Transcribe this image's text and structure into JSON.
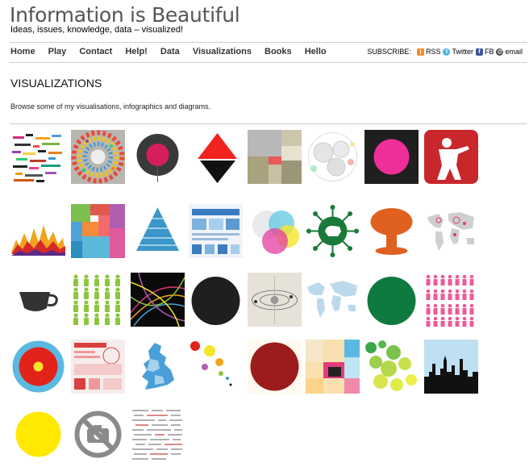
{
  "site": {
    "title": "Information is Beautiful",
    "tagline": "Ideas, issues, knowledge, data – visualized!"
  },
  "nav": {
    "items": [
      "Home",
      "Play",
      "Contact",
      "Help!",
      "Data",
      "Visualizations",
      "Books",
      "Hello"
    ]
  },
  "subscribe": {
    "label": "SUBSCRIBE:",
    "links": [
      {
        "label": "RSS",
        "icon": "rss-icon",
        "color": "#f08a24"
      },
      {
        "label": "Twitter",
        "icon": "twitter-icon",
        "color": "#49b3e6"
      },
      {
        "label": "FB",
        "icon": "facebook-icon",
        "color": "#3b5998"
      },
      {
        "label": "email",
        "icon": "email-icon",
        "color": "#444444"
      }
    ]
  },
  "page": {
    "title": "VISUALIZATIONS",
    "intro": "Browse some of my visualisations, infographics and diagrams."
  },
  "thumbnails": [
    {
      "name": "thumb-color-chart"
    },
    {
      "name": "thumb-color-wheel"
    },
    {
      "name": "thumb-dark-circle"
    },
    {
      "name": "thumb-triangles"
    },
    {
      "name": "thumb-treemap-beige"
    },
    {
      "name": "thumb-circle-network"
    },
    {
      "name": "thumb-pink-dot"
    },
    {
      "name": "thumb-soldier"
    },
    {
      "name": "thumb-mountain-chart"
    },
    {
      "name": "thumb-colored-treemap"
    },
    {
      "name": "thumb-pyramid"
    },
    {
      "name": "thumb-blue-infographic"
    },
    {
      "name": "thumb-venn-diagram"
    },
    {
      "name": "thumb-virus"
    },
    {
      "name": "thumb-mushroom-cloud"
    },
    {
      "name": "thumb-world-map-pink"
    },
    {
      "name": "thumb-teacup"
    },
    {
      "name": "thumb-green-people"
    },
    {
      "name": "thumb-rainbow-lines"
    },
    {
      "name": "thumb-black-circle"
    },
    {
      "name": "thumb-orbit-diagram"
    },
    {
      "name": "thumb-world-map-blue"
    },
    {
      "name": "thumb-green-circle"
    },
    {
      "name": "thumb-pink-people"
    },
    {
      "name": "thumb-target"
    },
    {
      "name": "thumb-red-infographic"
    },
    {
      "name": "thumb-uk-map"
    },
    {
      "name": "thumb-dot-sizes"
    },
    {
      "name": "thumb-red-circle"
    },
    {
      "name": "thumb-squares-grid"
    },
    {
      "name": "thumb-green-bubbles"
    },
    {
      "name": "thumb-skyline"
    },
    {
      "name": "thumb-yellow-circle"
    },
    {
      "name": "thumb-no-camera"
    },
    {
      "name": "thumb-word-cloud"
    }
  ]
}
